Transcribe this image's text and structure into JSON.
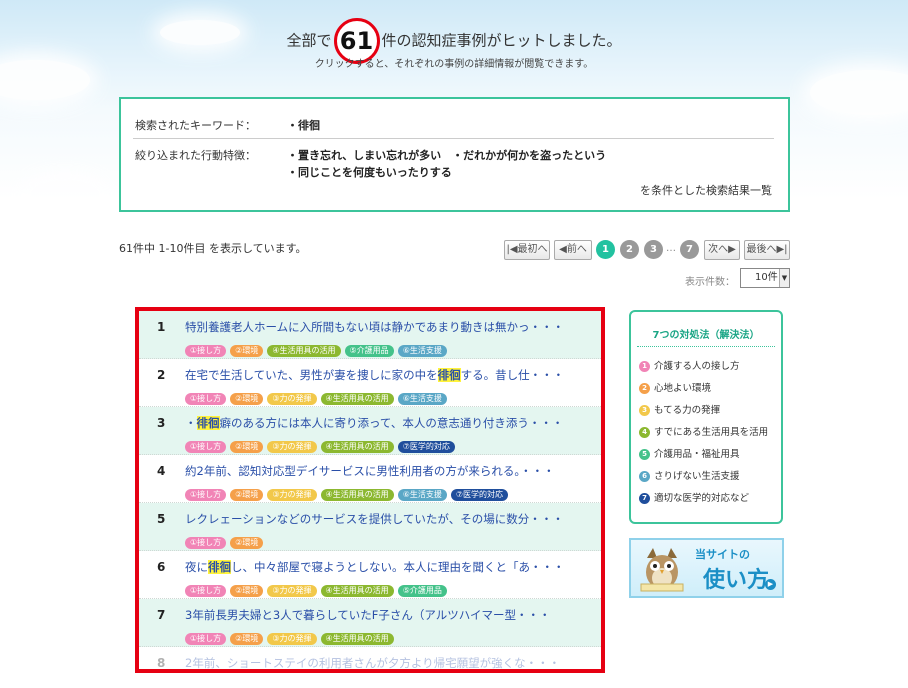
{
  "header": {
    "prefix": "全部で",
    "count": "61",
    "suffix": "件の認知症事例がヒットしました。",
    "sub": "クリックすると、それぞれの事例の詳細情報が閲覧できます。"
  },
  "keywords": {
    "label": "検索されたキーワード：",
    "value": "・徘徊",
    "filter_label": "絞り込まれた行動特徴：",
    "filter_line1": "・置き忘れ、しまい忘れが多い　・だれかが何かを盗ったという",
    "filter_line2": "・同じことを何度もいったりする",
    "footer": "を条件とした検索結果一覧"
  },
  "result_info": "61件中 1-10件目 を表示しています。",
  "pager": {
    "first": "最初へ",
    "prev": "前へ",
    "pages": [
      "1",
      "2",
      "3",
      "7"
    ],
    "dots": "…",
    "next": "次へ",
    "last": "最後へ"
  },
  "per_page": {
    "label": "表示件数：",
    "value": "10件"
  },
  "tags": {
    "t1": "①接し方",
    "t2": "②環境",
    "t3": "③力の発揮",
    "t4": "④生活用具の活用",
    "t5": "⑤介護用品",
    "t6": "⑥生活支援",
    "t7": "⑦医学的対応"
  },
  "results": [
    {
      "num": "1",
      "title": "特別養護老人ホームに入所間もない頃は静かであまり動きは無かっ・・・"
    },
    {
      "num": "2",
      "title_a": "在宅で生活していた、男性が妻を捜しに家の中を",
      "hl": "徘徊",
      "title_b": "する。昔し仕・・・"
    },
    {
      "num": "3",
      "title_a": "・",
      "hl": "徘徊",
      "title_b": "癖のある方には本人に寄り添って、本人の意志通り付き添う・・・"
    },
    {
      "num": "4",
      "title": "約2年前、認知対応型デイサービスに男性利用者の方が来られる。・・・"
    },
    {
      "num": "5",
      "title": "レクレェーションなどのサービスを提供していたが、その場に数分・・・"
    },
    {
      "num": "6",
      "title_a": "夜に",
      "hl": "徘徊",
      "title_b": "し、中々部屋で寝ようとしない。本人に理由を聞くと「あ・・・"
    },
    {
      "num": "7",
      "title": "3年前長男夫婦と3人で暮らしていたF子さん（アルツハイマー型・・・"
    },
    {
      "num": "8",
      "title": "2年前、ショートステイの利用者さんが夕方より帰宅願望が強くな・・・"
    }
  ],
  "side": {
    "heading": "7つの対処法（解決法）",
    "items": [
      {
        "n": "1",
        "label": "介護する人の接し方",
        "color": "#f184b6"
      },
      {
        "n": "2",
        "label": "心地よい環境",
        "color": "#f5a04a"
      },
      {
        "n": "3",
        "label": "もてる力の発揮",
        "color": "#f2c84a"
      },
      {
        "n": "4",
        "label": "すでにある生活用具を活用",
        "color": "#8cb830"
      },
      {
        "n": "5",
        "label": "介護用品・福祉用具",
        "color": "#44c28a"
      },
      {
        "n": "6",
        "label": "さりげない生活支援",
        "color": "#5aa7c6"
      },
      {
        "n": "7",
        "label": "適切な医学的対応など",
        "color": "#1f4e9c"
      }
    ]
  },
  "banner": {
    "line1": "当サイトの",
    "line2": "使い方"
  }
}
